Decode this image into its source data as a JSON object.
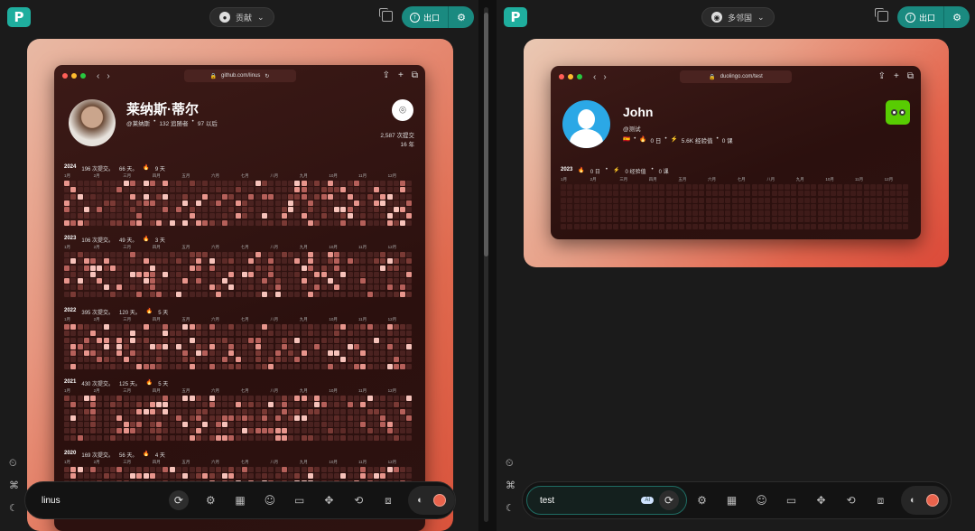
{
  "left": {
    "selector_label": "贡献",
    "export_label": "出口",
    "url": "github.com/linus",
    "profile": {
      "name": "莱纳斯·蒂尔",
      "handle": "@莱纳斯",
      "followers": "132 追随者",
      "following": "97 以后",
      "commits_total": "2,587 次提交",
      "years": "16 年"
    },
    "years": [
      {
        "year": "2024",
        "commits": "196 次提交。",
        "days": "66 天。",
        "streak": "9 天"
      },
      {
        "year": "2023",
        "commits": "106 次提交。",
        "days": "49 天。",
        "streak": "3 天"
      },
      {
        "year": "2022",
        "commits": "395 次提交。",
        "days": "120 天。",
        "streak": "5 天"
      },
      {
        "year": "2021",
        "commits": "430 次提交。",
        "days": "125 天。",
        "streak": "5 天"
      },
      {
        "year": "2020",
        "commits": "169 次提交。",
        "days": "56 天。",
        "streak": "4 天"
      }
    ],
    "months": [
      "1月",
      "2月",
      "三月",
      "四月",
      "五月",
      "六月",
      "七月",
      "八月",
      "九月",
      "10月",
      "11月",
      "12月"
    ],
    "input_value": "linus"
  },
  "right": {
    "selector_label": "多邻国",
    "export_label": "出口",
    "url": "duolingo.com/test",
    "profile": {
      "name": "John",
      "handle": "@测试",
      "streak": "0 日",
      "xp": "5.6K 经验值",
      "courses": "0 课",
      "flag": "🇪🇸"
    },
    "year_row": {
      "year": "2023",
      "days": "0 日",
      "xp": "0 经验值",
      "lessons": "0 课"
    },
    "months": [
      "1月",
      "2月",
      "三月",
      "四月",
      "五月",
      "六月",
      "七月",
      "八月",
      "九月",
      "10月",
      "11月",
      "12月"
    ],
    "input_value": "test",
    "input_badge": "AI"
  },
  "icons": {
    "github": "github-icon",
    "duolingo": "duolingo-icon",
    "refresh": "refresh-icon",
    "tune": "sliders-icon",
    "calendar": "calendar-icon",
    "smile": "smile-icon",
    "frame": "window-icon",
    "move": "move-icon",
    "rotate": "rotate-icon",
    "layers": "layers-icon",
    "palette": "palette-icon",
    "schedule": "schedule-icon",
    "command": "command-icon",
    "moon": "moon-icon"
  },
  "colors": {
    "accent": "#1a8a80",
    "frame": "#e06a4f",
    "swatch": "#e9634c"
  }
}
